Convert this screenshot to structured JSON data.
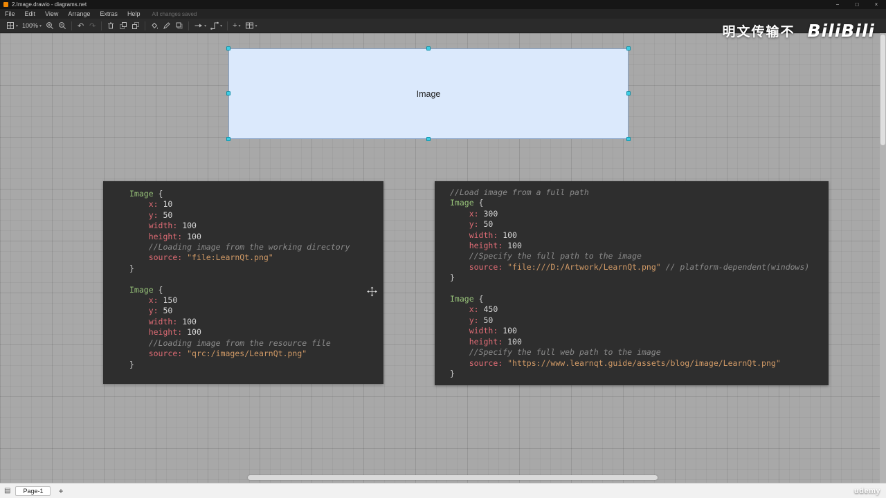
{
  "window": {
    "title": "2.Image.drawio - diagrams.net",
    "controls": {
      "minimize": "−",
      "maximize": "□",
      "close": "×"
    }
  },
  "menu": {
    "items": [
      "File",
      "Edit",
      "View",
      "Arrange",
      "Extras",
      "Help"
    ],
    "status": "All changes saved"
  },
  "toolbar": {
    "zoom_value": "100%"
  },
  "icons": {
    "caret": "▾",
    "undo": "↶",
    "redo": "↷",
    "plus": "+",
    "pages": "▤"
  },
  "canvas": {
    "shape": {
      "label": "Image"
    }
  },
  "watermarks": {
    "chinese": "明文传输不",
    "logo": "BiliBili",
    "udemy": "udemy"
  },
  "footer": {
    "page_tab": "Page-1",
    "add_label": "+"
  },
  "code_panels": {
    "left": {
      "lines": [
        [
          [
            "kw",
            "Image"
          ],
          [
            "plain",
            " {"
          ]
        ],
        [
          [
            "plain",
            "    "
          ],
          [
            "prop",
            "x:"
          ],
          [
            "plain",
            " "
          ],
          [
            "num",
            "10"
          ]
        ],
        [
          [
            "plain",
            "    "
          ],
          [
            "prop",
            "y:"
          ],
          [
            "plain",
            " "
          ],
          [
            "num",
            "50"
          ]
        ],
        [
          [
            "plain",
            "    "
          ],
          [
            "prop",
            "width:"
          ],
          [
            "plain",
            " "
          ],
          [
            "num",
            "100"
          ]
        ],
        [
          [
            "plain",
            "    "
          ],
          [
            "prop",
            "height:"
          ],
          [
            "plain",
            " "
          ],
          [
            "num",
            "100"
          ]
        ],
        [
          [
            "plain",
            "    "
          ],
          [
            "com",
            "//Loading image from the working directory"
          ]
        ],
        [
          [
            "plain",
            "    "
          ],
          [
            "prop",
            "source:"
          ],
          [
            "plain",
            " "
          ],
          [
            "str",
            "\"file:LearnQt.png\""
          ]
        ],
        [
          [
            "plain",
            "}"
          ]
        ],
        [],
        [
          [
            "kw",
            "Image"
          ],
          [
            "plain",
            " {"
          ]
        ],
        [
          [
            "plain",
            "    "
          ],
          [
            "prop",
            "x:"
          ],
          [
            "plain",
            " "
          ],
          [
            "num",
            "150"
          ]
        ],
        [
          [
            "plain",
            "    "
          ],
          [
            "prop",
            "y:"
          ],
          [
            "plain",
            " "
          ],
          [
            "num",
            "50"
          ]
        ],
        [
          [
            "plain",
            "    "
          ],
          [
            "prop",
            "width:"
          ],
          [
            "plain",
            " "
          ],
          [
            "num",
            "100"
          ]
        ],
        [
          [
            "plain",
            "    "
          ],
          [
            "prop",
            "height:"
          ],
          [
            "plain",
            " "
          ],
          [
            "num",
            "100"
          ]
        ],
        [
          [
            "plain",
            "    "
          ],
          [
            "com",
            "//Loading image from the resource file"
          ]
        ],
        [
          [
            "plain",
            "    "
          ],
          [
            "prop",
            "source:"
          ],
          [
            "plain",
            " "
          ],
          [
            "str",
            "\"qrc:/images/LearnQt.png\""
          ]
        ],
        [
          [
            "plain",
            "}"
          ]
        ]
      ]
    },
    "right": {
      "lines": [
        [
          [
            "com",
            "//Load image from a full path"
          ]
        ],
        [
          [
            "kw",
            "Image"
          ],
          [
            "plain",
            " {"
          ]
        ],
        [
          [
            "plain",
            "    "
          ],
          [
            "prop",
            "x:"
          ],
          [
            "plain",
            " "
          ],
          [
            "num",
            "300"
          ]
        ],
        [
          [
            "plain",
            "    "
          ],
          [
            "prop",
            "y:"
          ],
          [
            "plain",
            " "
          ],
          [
            "num",
            "50"
          ]
        ],
        [
          [
            "plain",
            "    "
          ],
          [
            "prop",
            "width:"
          ],
          [
            "plain",
            " "
          ],
          [
            "num",
            "100"
          ]
        ],
        [
          [
            "plain",
            "    "
          ],
          [
            "prop",
            "height:"
          ],
          [
            "plain",
            " "
          ],
          [
            "num",
            "100"
          ]
        ],
        [
          [
            "plain",
            "    "
          ],
          [
            "com",
            "//Specify the full path to the image"
          ]
        ],
        [
          [
            "plain",
            "    "
          ],
          [
            "prop",
            "source:"
          ],
          [
            "plain",
            " "
          ],
          [
            "str",
            "\"file:///D:/Artwork/LearnQt.png\""
          ],
          [
            "plain",
            " "
          ],
          [
            "com",
            "// platform-dependent(windows)"
          ]
        ],
        [
          [
            "plain",
            "}"
          ]
        ],
        [],
        [
          [
            "kw",
            "Image"
          ],
          [
            "plain",
            " {"
          ]
        ],
        [
          [
            "plain",
            "    "
          ],
          [
            "prop",
            "x:"
          ],
          [
            "plain",
            " "
          ],
          [
            "num",
            "450"
          ]
        ],
        [
          [
            "plain",
            "    "
          ],
          [
            "prop",
            "y:"
          ],
          [
            "plain",
            " "
          ],
          [
            "num",
            "50"
          ]
        ],
        [
          [
            "plain",
            "    "
          ],
          [
            "prop",
            "width:"
          ],
          [
            "plain",
            " "
          ],
          [
            "num",
            "100"
          ]
        ],
        [
          [
            "plain",
            "    "
          ],
          [
            "prop",
            "height:"
          ],
          [
            "plain",
            " "
          ],
          [
            "num",
            "100"
          ]
        ],
        [
          [
            "plain",
            "    "
          ],
          [
            "com",
            "//Specify the full web path to the image"
          ]
        ],
        [
          [
            "plain",
            "    "
          ],
          [
            "prop",
            "source:"
          ],
          [
            "plain",
            " "
          ],
          [
            "str",
            "\"https://www.learnqt.guide/assets/blog/image/LearnQt.png\""
          ]
        ],
        [
          [
            "plain",
            "}"
          ]
        ]
      ]
    }
  }
}
